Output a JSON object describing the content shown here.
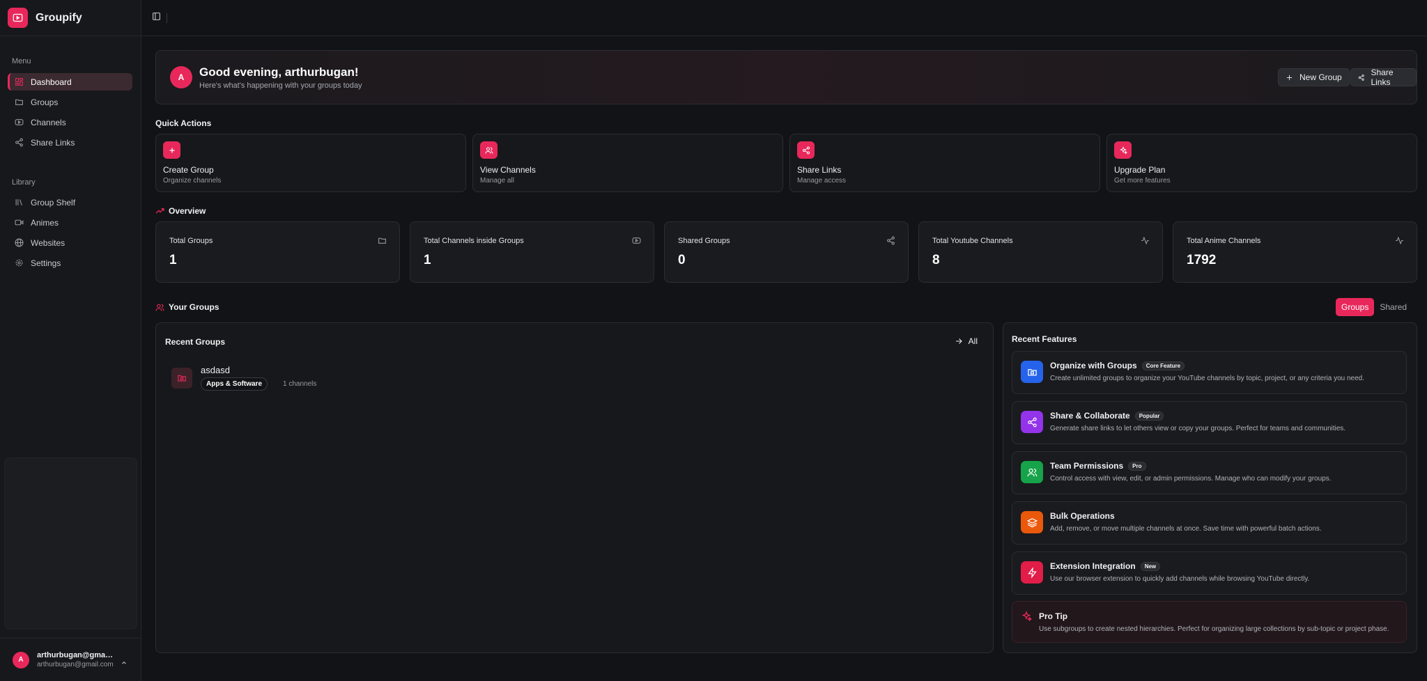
{
  "app": {
    "name": "Groupify"
  },
  "sidebar": {
    "menu_label": "Menu",
    "menu_items": [
      {
        "label": "Dashboard",
        "icon": "dashboard-icon",
        "active": true
      },
      {
        "label": "Groups",
        "icon": "folder-icon"
      },
      {
        "label": "Channels",
        "icon": "youtube-icon"
      },
      {
        "label": "Share Links",
        "icon": "share-icon"
      }
    ],
    "library_label": "Library",
    "library_items": [
      {
        "label": "Group Shelf",
        "icon": "library-icon"
      },
      {
        "label": "Animes",
        "icon": "video-icon"
      },
      {
        "label": "Websites",
        "icon": "globe-icon"
      },
      {
        "label": "Settings",
        "icon": "gear-icon"
      }
    ],
    "user": {
      "initial": "A",
      "name": "arthurbugan@gmai...",
      "email": "arthurbugan@gmail.com"
    }
  },
  "greeting": {
    "initial": "A",
    "title": "Good evening, arthurbugan!",
    "subtitle": "Here's what's happening with your groups today",
    "new_group_label": "New Group",
    "share_links_label": "Share Links"
  },
  "quick_actions": {
    "heading": "Quick Actions",
    "items": [
      {
        "title": "Create Group",
        "subtitle": "Organize channels",
        "icon": "plus-icon"
      },
      {
        "title": "View Channels",
        "subtitle": "Manage all",
        "icon": "users-icon"
      },
      {
        "title": "Share Links",
        "subtitle": "Manage access",
        "icon": "share-icon"
      },
      {
        "title": "Upgrade Plan",
        "subtitle": "Get more features",
        "icon": "sparkles-icon"
      }
    ]
  },
  "overview": {
    "heading": "Overview",
    "stats": [
      {
        "label": "Total Groups",
        "value": "1",
        "icon": "folder-icon"
      },
      {
        "label": "Total Channels inside Groups",
        "value": "1",
        "icon": "youtube-icon"
      },
      {
        "label": "Shared Groups",
        "value": "0",
        "icon": "share-icon"
      },
      {
        "label": "Total Youtube Channels",
        "value": "8",
        "icon": "activity-icon"
      },
      {
        "label": "Total Anime Channels",
        "value": "1792",
        "icon": "activity-icon"
      }
    ]
  },
  "your_groups": {
    "heading": "Your Groups",
    "tabs": [
      "Groups",
      "Shared"
    ],
    "active_tab": "Groups",
    "recent_title": "Recent Groups",
    "all_label": "All",
    "groups": [
      {
        "name": "asdasd",
        "category": "Apps & Software",
        "count": "1 channels"
      }
    ]
  },
  "recent_features": {
    "title": "Recent Features",
    "items": [
      {
        "title": "Organize with Groups",
        "badge": "Core Feature",
        "desc": "Create unlimited groups to organize your YouTube channels by topic, project, or any criteria you need.",
        "color": "#2563eb",
        "icon": "folder-icon"
      },
      {
        "title": "Share & Collaborate",
        "badge": "Popular",
        "desc": "Generate share links to let others view or copy your groups. Perfect for teams and communities.",
        "color": "#9333ea",
        "icon": "share-icon"
      },
      {
        "title": "Team Permissions",
        "badge": "Pro",
        "desc": "Control access with view, edit, or admin permissions. Manage who can modify your groups.",
        "color": "#16a34a",
        "icon": "users-icon"
      },
      {
        "title": "Bulk Operations",
        "badge": "",
        "desc": "Add, remove, or move multiple channels at once. Save time with powerful batch actions.",
        "color": "#ea580c",
        "icon": "layers-icon"
      },
      {
        "title": "Extension Integration",
        "badge": "New",
        "desc": "Use our browser extension to quickly add channels while browsing YouTube directly.",
        "color": "#e11d48",
        "icon": "zap-icon"
      }
    ],
    "protip": {
      "title": "Pro Tip",
      "desc": "Use subgroups to create nested hierarchies. Perfect for organizing large collections by sub-topic or project phase."
    }
  },
  "colors": {
    "accent": "#e8285b",
    "background": "#121316",
    "sidebar": "#17181b"
  }
}
